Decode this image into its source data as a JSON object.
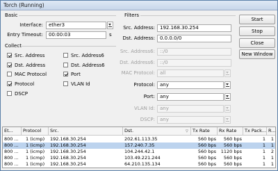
{
  "window": {
    "title": "Torch (Running)"
  },
  "basic": {
    "heading": "Basic",
    "interface_label": "Interface:",
    "interface_value": "ether3",
    "entry_timeout_label": "Entry Timeout:",
    "entry_timeout_value": "00:00:03",
    "entry_timeout_unit": "s"
  },
  "collect": {
    "heading": "Collect",
    "items": [
      {
        "label": "Src. Address",
        "checked": true
      },
      {
        "label": "Src. Address6",
        "checked": false
      },
      {
        "label": "Dst. Address",
        "checked": true
      },
      {
        "label": "Dst. Address6",
        "checked": false
      },
      {
        "label": "MAC Protocol",
        "checked": false
      },
      {
        "label": "Port",
        "checked": true
      },
      {
        "label": "Protocol",
        "checked": true
      },
      {
        "label": "VLAN Id",
        "checked": false
      },
      {
        "label": "DSCP",
        "checked": false
      }
    ]
  },
  "filters": {
    "heading": "Filters",
    "src_address_label": "Src. Address:",
    "src_address_value": "192.168.30.254",
    "dst_address_label": "Dst. Address:",
    "dst_address_value": "0.0.0.0/0",
    "src_address6_label": "Src. Address6:",
    "src_address6_value": "::/0",
    "dst_address6_label": "Dst. Address6:",
    "dst_address6_value": "::/0",
    "mac_protocol_label": "MAC Protocol:",
    "mac_protocol_value": "all",
    "protocol_label": "Protocol:",
    "protocol_value": "any",
    "port_label": "Port:",
    "port_value": "any",
    "vlan_id_label": "VLAN Id:",
    "vlan_id_value": "any",
    "dscp_label": "DSCP:",
    "dscp_value": "any"
  },
  "buttons": {
    "start": "Start",
    "stop": "Stop",
    "close": "Close",
    "new_window": "New Window"
  },
  "table": {
    "columns": [
      "Et...",
      "Protocol",
      "Src.",
      "Dst.",
      "Tx Rate",
      "Rx Rate",
      "Tx Pack...",
      "R..."
    ],
    "rows": [
      {
        "eth": "800 ...",
        "protocol": "1 (icmp)",
        "src": "192.168.30.254",
        "dst": "202.61.113.35",
        "tx": "560 bps",
        "rx": "560 bps",
        "txp": "1",
        "rxp": "1",
        "selected": false
      },
      {
        "eth": "800 ...",
        "protocol": "1 (icmp)",
        "src": "192.168.30.254",
        "dst": "157.240.7.35",
        "tx": "560 bps",
        "rx": "560 bps",
        "txp": "1",
        "rxp": "1",
        "selected": true
      },
      {
        "eth": "800 ...",
        "protocol": "1 (icmp)",
        "src": "192.168.30.254",
        "dst": "104.244.42.1",
        "tx": "560 bps",
        "rx": "1120 bps",
        "txp": "1",
        "rxp": "2",
        "selected": false
      },
      {
        "eth": "800 ...",
        "protocol": "1 (icmp)",
        "src": "192.168.30.254",
        "dst": "103.49.221.244",
        "tx": "560 bps",
        "rx": "560 bps",
        "txp": "1",
        "rxp": "1",
        "selected": false
      },
      {
        "eth": "800 ...",
        "protocol": "1 (icmp)",
        "src": "192.168.30.254",
        "dst": "64.210.135.134",
        "tx": "560 bps",
        "rx": "560 bps",
        "txp": "1",
        "rxp": "1",
        "selected": false
      }
    ]
  }
}
